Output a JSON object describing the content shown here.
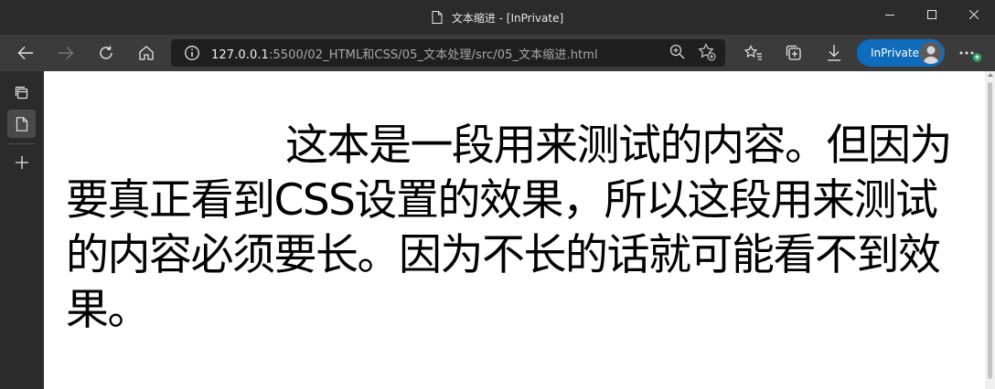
{
  "window": {
    "title": "文本缩进 - [InPrivate]",
    "icon": "page-icon"
  },
  "window_controls": [
    "minimize-icon",
    "maximize-icon",
    "close-icon"
  ],
  "toolbar": {
    "back_icon": "back-arrow-icon",
    "forward_icon": "forward-arrow-icon",
    "refresh_icon": "refresh-icon",
    "home_icon": "home-icon",
    "inprivate_label": "InPrivate"
  },
  "address": {
    "host": "127.0.0.1",
    "rest": ":5500/02_HTML和CSS/05_文本处理/src/05_文本缩进.html"
  },
  "address_icons": [
    "zoom-icon",
    "add-favorite-icon"
  ],
  "toolbar_right_icons": [
    "favorites-icon",
    "collections-icon",
    "downloads-icon",
    "more-icon"
  ],
  "sidebar": {
    "items": [
      "tab-actions-icon",
      "page-tab-icon",
      "new-tab-icon"
    ]
  },
  "page": {
    "paragraph": "这本是一段用来测试的内容。但因为要真正看到CSS设置的效果，所以这段用来测试的内容必须要长。因为不长的话就可能看不到效果。"
  }
}
